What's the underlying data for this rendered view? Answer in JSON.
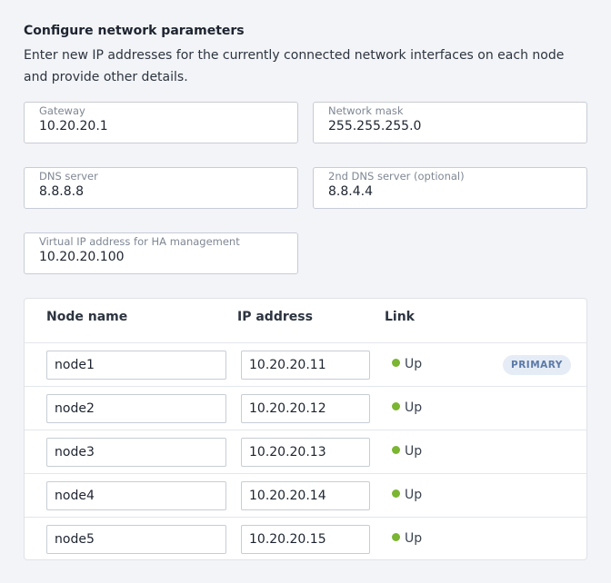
{
  "heading": "Configure network parameters",
  "description": "Enter new IP addresses for the currently connected network interfaces on each node and provide other details.",
  "fields": {
    "gateway": {
      "label": "Gateway",
      "value": "10.20.20.1"
    },
    "netmask": {
      "label": "Network mask",
      "value": "255.255.255.0"
    },
    "dns": {
      "label": "DNS server",
      "value": "8.8.8.8"
    },
    "dns2": {
      "label": "2nd DNS server (optional)",
      "value": "8.8.4.4"
    },
    "vip": {
      "label": "Virtual IP address for HA management",
      "value": "10.20.20.100"
    }
  },
  "table": {
    "headers": [
      "Node name",
      "IP address",
      "Link"
    ],
    "rows": [
      {
        "name": "node1",
        "ip": "10.20.20.11",
        "link": "Up",
        "badge": "PRIMARY"
      },
      {
        "name": "node2",
        "ip": "10.20.20.12",
        "link": "Up"
      },
      {
        "name": "node3",
        "ip": "10.20.20.13",
        "link": "Up"
      },
      {
        "name": "node4",
        "ip": "10.20.20.14",
        "link": "Up"
      },
      {
        "name": "node5",
        "ip": "10.20.20.15",
        "link": "Up"
      }
    ]
  },
  "colors": {
    "link_up": "#7bb531",
    "badge_bg": "#e6ecf5",
    "badge_text": "#5b7aa8"
  }
}
